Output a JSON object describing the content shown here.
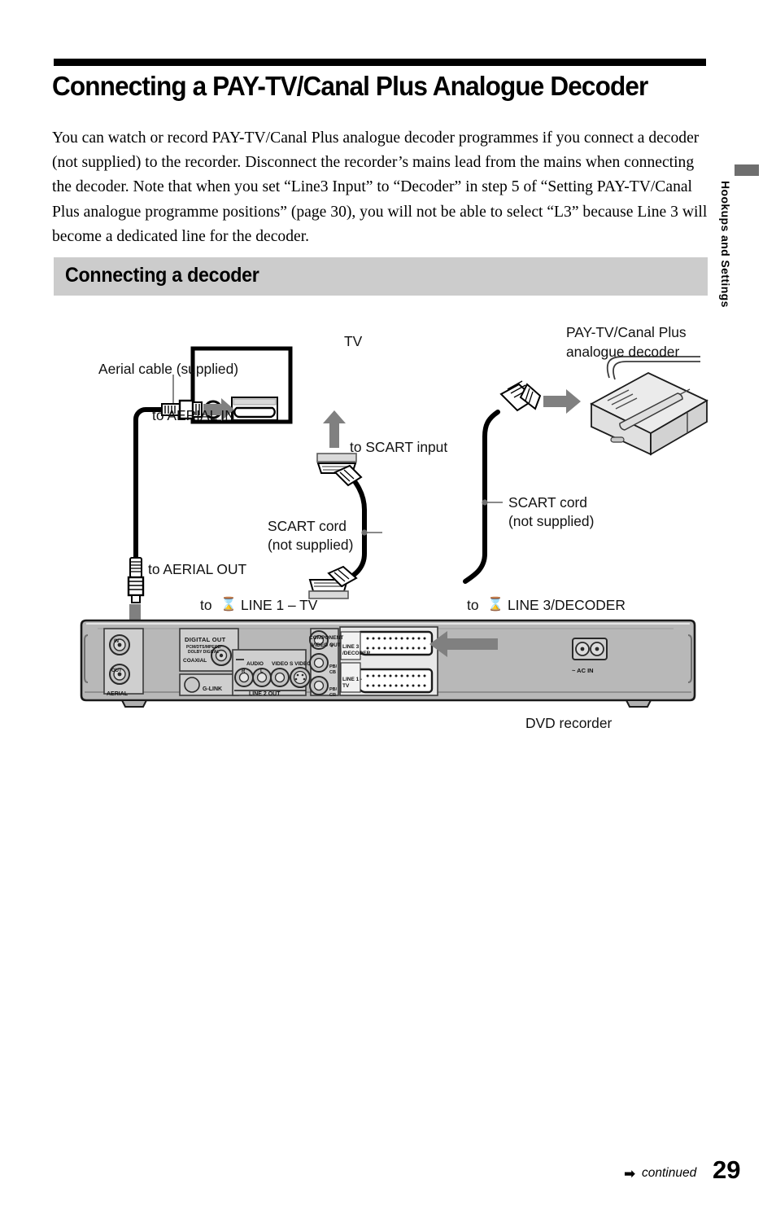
{
  "header": {
    "title": "Connecting a PAY-TV/Canal Plus Analogue Decoder",
    "intro": "You can watch or record PAY-TV/Canal Plus analogue decoder programmes if you connect a decoder (not supplied) to the recorder. Disconnect the recorder’s mains lead from the mains when connecting the decoder. Note that when you set “Line3 Input” to “Decoder” in step 5 of “Setting PAY-TV/Canal Plus analogue programme positions” (page 30), you will not be able to select “L3” because Line 3 will become a dedicated line for the decoder."
  },
  "section": {
    "heading": "Connecting a decoder"
  },
  "side_tab": {
    "label": "Hookups and Settings"
  },
  "figure": {
    "tv_label": "TV",
    "decoder_label_line1": "PAY-TV/Canal Plus",
    "decoder_label_line2": "analogue decoder",
    "aerial_cable": "Aerial cable (supplied)",
    "to_aerial_in": "to AERIAL IN",
    "to_scart_input": "to SCART input",
    "scart_cord_left_line1": "SCART cord",
    "scart_cord_left_line2": "(not supplied)",
    "scart_cord_right_line1": "SCART cord",
    "scart_cord_right_line2": "(not supplied)",
    "to_aerial_out": "to AERIAL OUT",
    "to_line1_prefix": "to",
    "to_line1": "LINE 1 – TV",
    "to_line3_prefix": "to",
    "to_line3": "LINE 3/DECODER",
    "dvd_recorder": "DVD recorder"
  },
  "rear_panel": {
    "aerial": "AERIAL",
    "aerial_in": "IN",
    "aerial_out": "OUT",
    "digital_out": "DIGITAL OUT",
    "digital_out_sub1": "PCM/DTS/MPEG2/",
    "digital_out_sub2": "DOLBY DIGITAL",
    "coaxial": "COAXIAL",
    "g_link": "G-LINK",
    "audio": "AUDIO",
    "audio_r": "R",
    "audio_l": "L",
    "video": "VIDEO",
    "s_video": "S VIDEO",
    "line2_out": "LINE 2 OUT",
    "component": "COMPONENT",
    "component_video_out": "VIDEO OUT",
    "comp_y": "Y",
    "comp_pb1": "PB/",
    "comp_cb1": "CB",
    "comp_pb2": "PB/",
    "comp_cb2": "CR",
    "scart_line3_l1": "LINE 3",
    "scart_line3_l2": "/DECODER",
    "scart_line1_l1": "LINE 1 -",
    "scart_line1_l2": "TV",
    "ac_in": "~ AC IN"
  },
  "footer": {
    "continued": "continued",
    "continued_arrow": "➡",
    "page_number": "29"
  },
  "colors": {
    "arrow_gray": "#808080",
    "panel_gray": "#b8b8b8",
    "subbar_gray": "#cccccc",
    "tab_gray": "#6e6e6e",
    "ink": "#000000"
  }
}
